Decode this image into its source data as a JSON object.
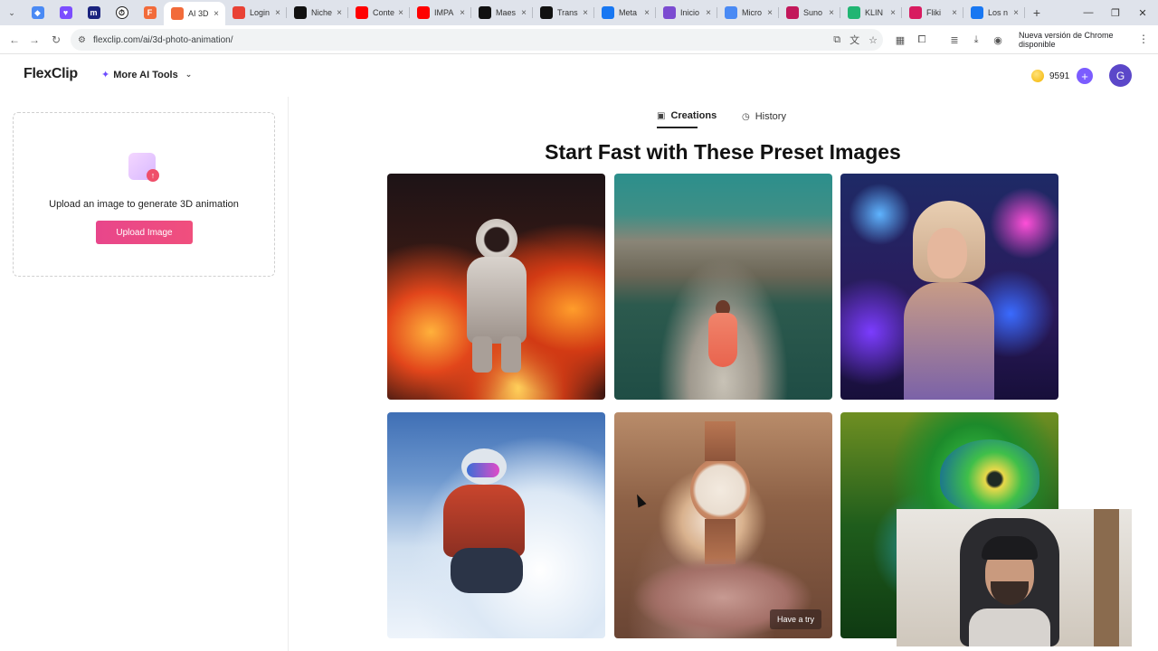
{
  "browser": {
    "tabs": [
      {
        "title": "AI 3D",
        "icon": "flexclip-icon",
        "color": "#f26b3a",
        "active": true
      },
      {
        "title": "Login",
        "icon": "login-icon",
        "color": "#e94235"
      },
      {
        "title": "Niche",
        "icon": "threads-icon",
        "color": "#111111"
      },
      {
        "title": "Conte",
        "icon": "youtube-icon",
        "color": "#ff0000"
      },
      {
        "title": "IMPA",
        "icon": "youtube-icon",
        "color": "#ff0000"
      },
      {
        "title": "Maes",
        "icon": "tiktok-icon",
        "color": "#111111"
      },
      {
        "title": "Trans",
        "icon": "tiktok-icon",
        "color": "#111111"
      },
      {
        "title": "Meta",
        "icon": "meta-icon",
        "color": "#1877f2"
      },
      {
        "title": "Inicio",
        "icon": "app-icon",
        "color": "#7b4bd1"
      },
      {
        "title": "Micro",
        "icon": "microsoft-icon",
        "color": "#4a8af4"
      },
      {
        "title": "Suno",
        "icon": "suno-icon",
        "color": "#c2185b"
      },
      {
        "title": "KLIN",
        "icon": "kling-icon",
        "color": "#21b573"
      },
      {
        "title": "Fliki",
        "icon": "fliki-icon",
        "color": "#d81b60"
      },
      {
        "title": "Los n",
        "icon": "facebook-icon",
        "color": "#1877f2"
      }
    ],
    "url": "flexclip.com/ai/3d-photo-animation/",
    "update_label": "Nueva versión de Chrome disponible"
  },
  "header": {
    "logo": "FlexClip",
    "more_tools_label": "More AI Tools",
    "credits": "9591",
    "avatar_initial": "G"
  },
  "upload": {
    "text": "Upload an image to generate 3D animation",
    "button_label": "Upload Image"
  },
  "main": {
    "tabs": [
      {
        "label": "Creations",
        "active": true
      },
      {
        "label": "History",
        "active": false
      }
    ],
    "title": "Start Fast with These Preset Images",
    "presets": [
      {
        "name": "astronaut-lava"
      },
      {
        "name": "woman-mountain-lake"
      },
      {
        "name": "woman-neon-city"
      },
      {
        "name": "skier-snow"
      },
      {
        "name": "watch-roses",
        "hover_label": "Have a try"
      },
      {
        "name": "chameleon"
      }
    ]
  },
  "colors": {
    "accent": "#7b5cff",
    "upload_button": "#ec4a86"
  }
}
